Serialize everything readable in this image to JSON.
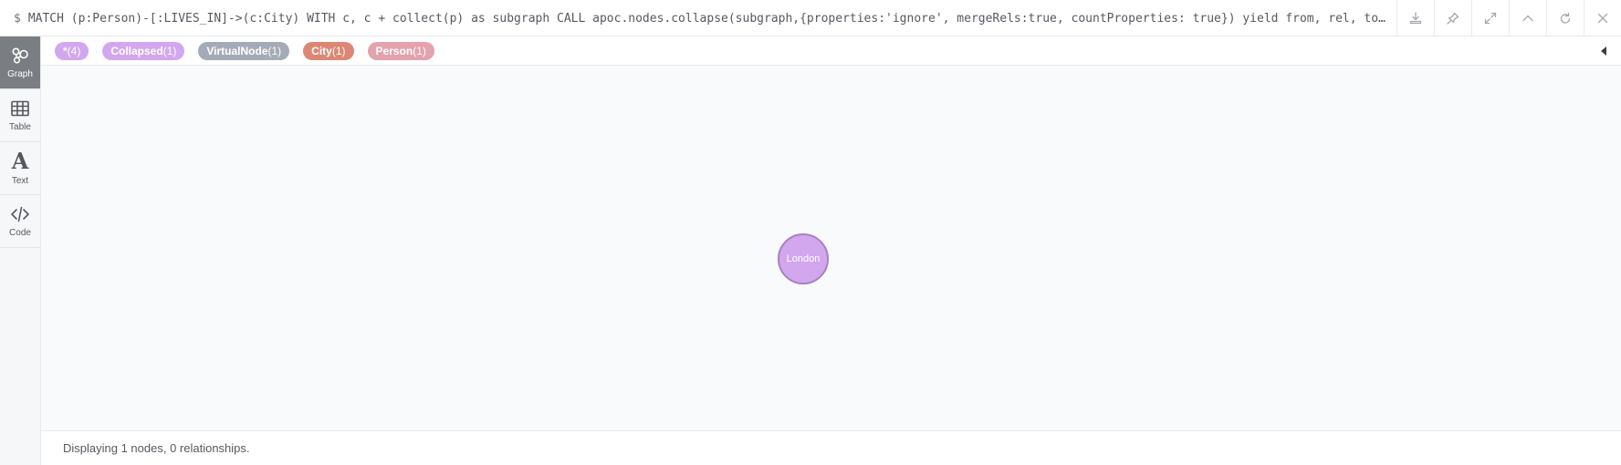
{
  "query": {
    "prompt": "$",
    "text": "MATCH (p:Person)-[:LIVES_IN]->(c:City) WITH c, c + collect(p) as subgraph CALL apoc.nodes.collapse(subgraph,{properties:'ignore', mergeRels:true, countProperties: true}) yield from, rel, to return from, rel, to"
  },
  "actions": [
    {
      "icon": "download-icon"
    },
    {
      "icon": "pin-icon"
    },
    {
      "icon": "expand-icon"
    },
    {
      "icon": "chevron-up-icon"
    },
    {
      "icon": "rerun-icon"
    },
    {
      "icon": "close-icon"
    }
  ],
  "sidebar": {
    "items": [
      {
        "label": "Graph",
        "icon": "graph-icon",
        "active": true
      },
      {
        "label": "Table",
        "icon": "table-icon",
        "active": false
      },
      {
        "label": "Text",
        "icon": "text-icon",
        "active": false
      },
      {
        "label": "Code",
        "icon": "code-icon",
        "active": false
      }
    ]
  },
  "legend": {
    "pills": [
      {
        "name": "*",
        "count": "(4)",
        "color": "#d3a7ee"
      },
      {
        "name": "Collapsed",
        "count": "(1)",
        "color": "#d3a7ee"
      },
      {
        "name": "VirtualNode",
        "count": "(1)",
        "color": "#a5abb6"
      },
      {
        "name": "City",
        "count": "(1)",
        "color": "#db8774"
      },
      {
        "name": "Person",
        "count": "(1)",
        "color": "#e4a2ad"
      }
    ]
  },
  "graph": {
    "nodes": [
      {
        "label": "London",
        "color": "#d3a7ee",
        "border": "#a97fc4"
      }
    ]
  },
  "status": {
    "text": "Displaying 1 nodes, 0 relationships."
  }
}
